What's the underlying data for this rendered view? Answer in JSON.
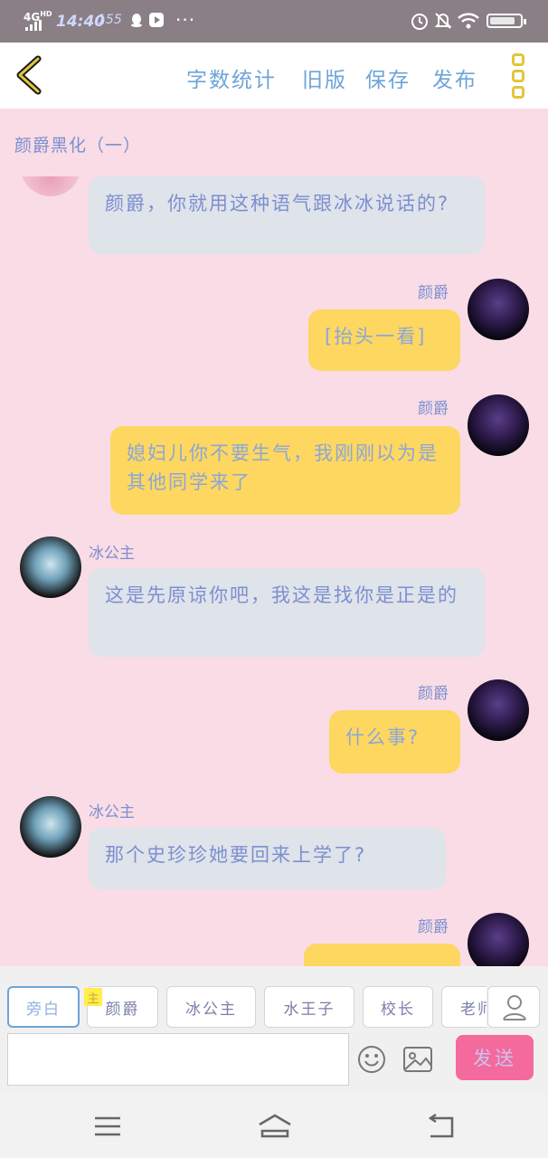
{
  "status_bar": {
    "network": "4G",
    "network_sup": "HD",
    "time": "14:40",
    "speed": "155",
    "battery_level": 0.85
  },
  "top_bar": {
    "actions": [
      "字数统计",
      "旧版",
      "保存",
      "发布"
    ]
  },
  "chat": {
    "title": "颜爵黑化（一）",
    "messages": [
      {
        "sender": "",
        "text": "颜爵，你就用这种语气跟冰冰说话的?",
        "side": "left"
      },
      {
        "sender": "颜爵",
        "text": "[抬头一看]",
        "side": "right"
      },
      {
        "sender": "颜爵",
        "text": "媳妇儿你不要生气，我刚刚以为是其他同学来了",
        "side": "right"
      },
      {
        "sender": "冰公主",
        "text": "这是先原谅你吧，我这是找你是正是的",
        "side": "left"
      },
      {
        "sender": "颜爵",
        "text": "什么事?",
        "side": "right"
      },
      {
        "sender": "冰公主",
        "text": "那个史珍珍她要回来上学了?",
        "side": "left"
      },
      {
        "sender": "颜爵",
        "text": "",
        "side": "right"
      }
    ]
  },
  "roles": {
    "main_tag": "主",
    "tabs": [
      "旁白",
      "颜爵",
      "冰公主",
      "水王子",
      "校长",
      "老师"
    ]
  },
  "composer": {
    "placeholder": "",
    "send_label": "发送"
  },
  "colors": {
    "background": "#f9dce6",
    "accent_blue": "#6ea4d8",
    "bubble_gray": "#dfe3ea",
    "bubble_yellow": "#fdd760",
    "send_pink": "#f46a9c",
    "menu_yellow": "#e1c63c"
  },
  "icons": {
    "back": "chevron-left-icon",
    "more": "more-vertical-icon",
    "person": "person-icon",
    "emoji": "emoji-icon",
    "image": "image-icon",
    "nav_menu": "menu-icon",
    "nav_home": "home-icon",
    "nav_back": "back-icon"
  }
}
